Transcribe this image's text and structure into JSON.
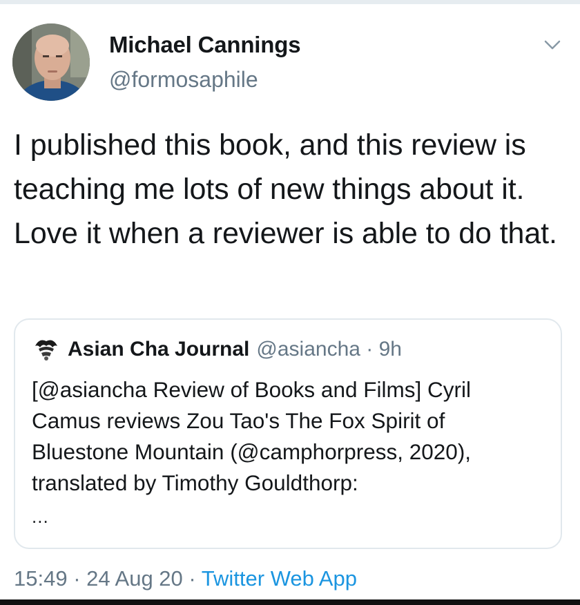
{
  "tweet": {
    "author": {
      "name": "Michael Cannings",
      "handle": "@formosaphile"
    },
    "text": "I published this book, and this review is teaching me lots of new things about it. Love it when a reviewer is able to do that.",
    "quoted": {
      "name": "Asian Cha Journal",
      "meta": "@asiancha · 9h",
      "text": "[@asiancha Review of Books and Films] Cyril Camus reviews Zou Tao's The Fox Spirit of Bluestone Mountain (@camphorpress, 2020), translated by Timothy Gouldthorp:",
      "more": "..."
    },
    "footer": {
      "time": "15:49",
      "date": "24 Aug 20",
      "source": "Twitter Web App"
    }
  },
  "icons": {
    "caret": "chevron-down-icon",
    "quote_logo": "asian-cha-logo"
  },
  "colors": {
    "text": "#14171a",
    "secondary": "#657786",
    "link": "#1b95e0",
    "border": "#e1e8ed"
  }
}
